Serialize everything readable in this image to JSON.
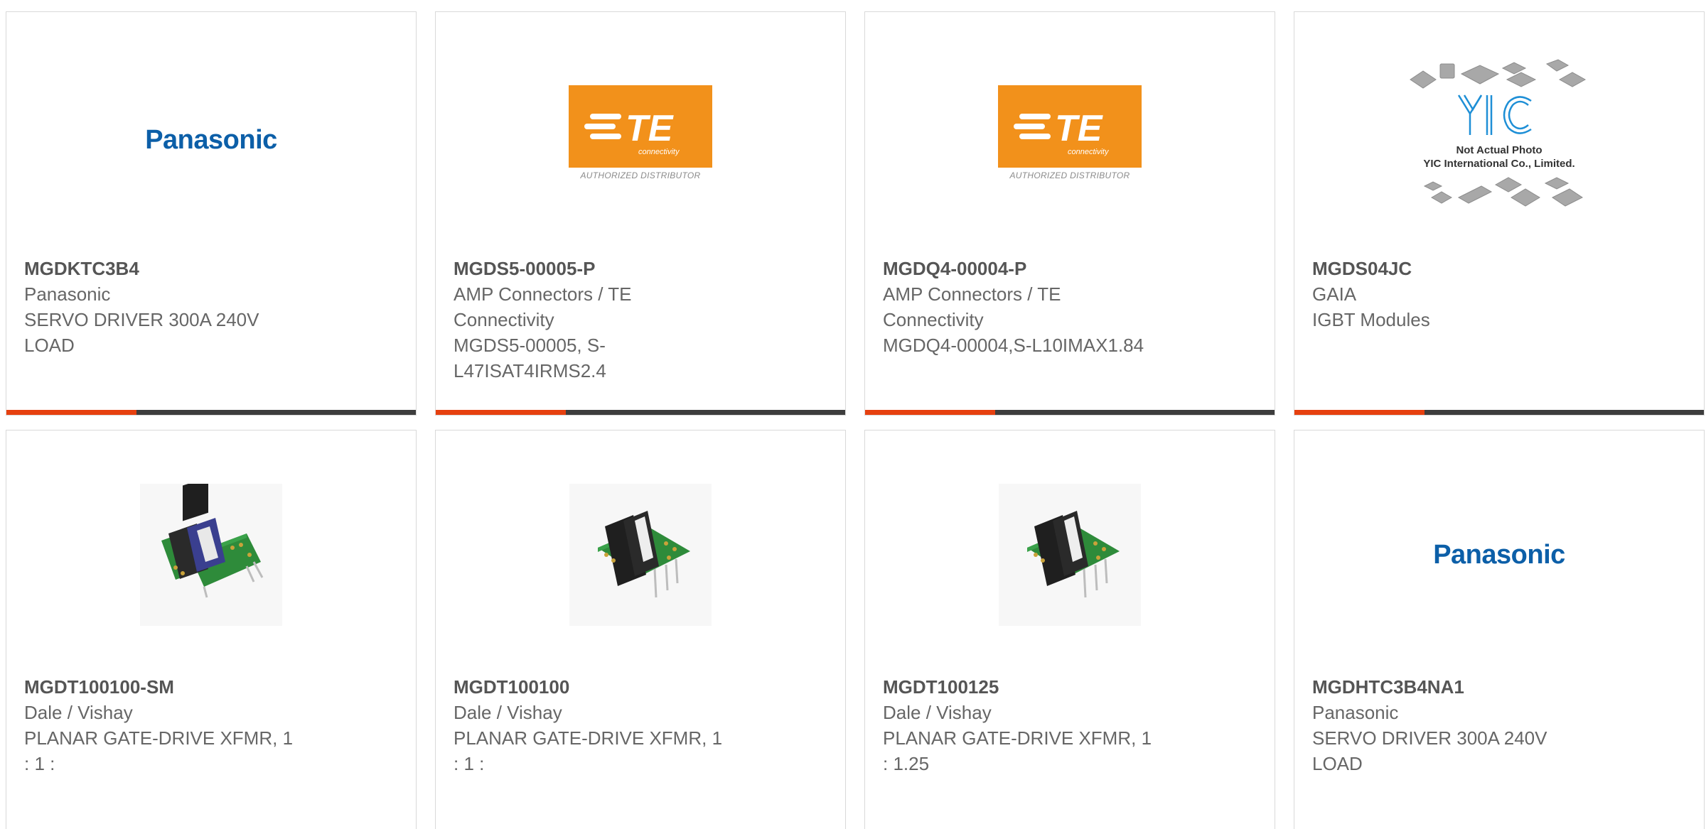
{
  "products": [
    {
      "part_number": "MGDKTC3B4",
      "manufacturer": "Panasonic",
      "description_lines": [
        "SERVO DRIVER 300A 240V",
        "LOAD"
      ],
      "image": "panasonic-logo",
      "logo_text": "Panasonic"
    },
    {
      "part_number": "MGDS5-00005-P",
      "manufacturer_lines": [
        "AMP Connectors / TE",
        "Connectivity"
      ],
      "description_lines": [
        "MGDS5-00005, S-",
        "L47ISAT4IRMS2.4"
      ],
      "image": "te-connectivity-logo",
      "logo_text": "TE",
      "logo_sub": "connectivity",
      "logo_caption": "AUTHORIZED DISTRIBUTOR"
    },
    {
      "part_number": "MGDQ4-00004-P",
      "manufacturer_lines": [
        "AMP Connectors / TE",
        "Connectivity"
      ],
      "description_lines": [
        "MGDQ4-00004,S-L10IMAX1.84"
      ],
      "image": "te-connectivity-logo",
      "logo_text": "TE",
      "logo_sub": "connectivity",
      "logo_caption": "AUTHORIZED DISTRIBUTOR"
    },
    {
      "part_number": "MGDS04JC",
      "manufacturer": "GAIA",
      "description_lines": [
        "IGBT Modules"
      ],
      "image": "yic-placeholder",
      "logo_text": "YIC",
      "placeholder_lines": [
        "Not Actual Photo",
        "YIC International Co., Limited."
      ]
    },
    {
      "part_number": "MGDT100100-SM",
      "manufacturer": "Dale / Vishay",
      "description_lines": [
        "PLANAR GATE-DRIVE XFMR, 1",
        ": 1 :"
      ],
      "image": "transformer-photo-blue"
    },
    {
      "part_number": "MGDT100100",
      "manufacturer": "Dale / Vishay",
      "description_lines": [
        "PLANAR GATE-DRIVE XFMR, 1",
        ": 1 :"
      ],
      "image": "transformer-photo-black"
    },
    {
      "part_number": "MGDT100125",
      "manufacturer": "Dale / Vishay",
      "description_lines": [
        "PLANAR GATE-DRIVE XFMR, 1",
        ": 1.25"
      ],
      "image": "transformer-photo-black"
    },
    {
      "part_number": "MGDHTC3B4NA1",
      "manufacturer": "Panasonic",
      "description_lines": [
        "SERVO DRIVER 300A 240V",
        "LOAD"
      ],
      "image": "panasonic-logo",
      "logo_text": "Panasonic"
    }
  ],
  "colors": {
    "accent": "#e6400f",
    "bar": "#3d3d3d",
    "panasonic_blue": "#0c5fa8",
    "te_orange": "#f2911b",
    "text": "#666666",
    "part_number": "#555555"
  }
}
